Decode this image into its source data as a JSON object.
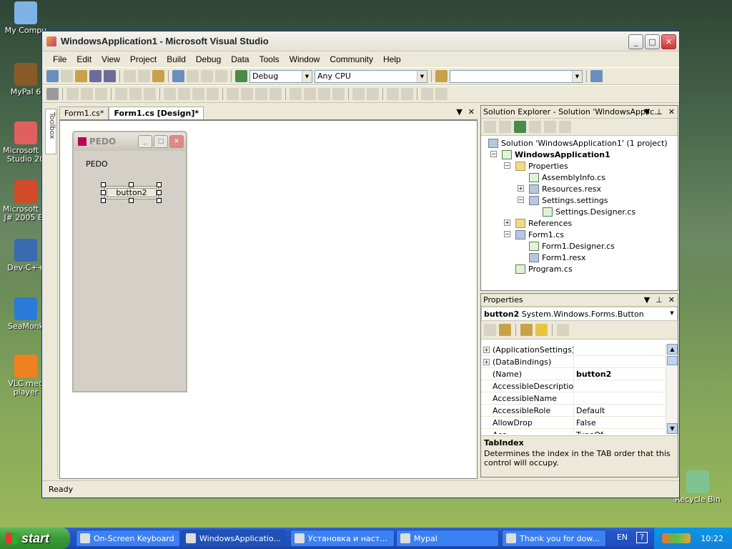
{
  "desktop": {
    "icons": [
      {
        "label": "My Compu",
        "color": "#7fb3e8"
      },
      {
        "label": "MyPal 6",
        "color": "#8a5a2a"
      },
      {
        "label": "Microsoft Vi\nStudio 20",
        "color": "#e06060"
      },
      {
        "label": "Microsoft Vi\nJ# 2005 Ex",
        "color": "#d24a2a"
      },
      {
        "label": "Dev-C++",
        "color": "#3a6ab0"
      },
      {
        "label": "SeaMonk",
        "color": "#2a7ad8"
      },
      {
        "label": "VLC med\nplayer",
        "color": "#f08020"
      },
      {
        "label": "Recycle Bin",
        "color": "#7fc48f"
      }
    ]
  },
  "window": {
    "title": "WindowsApplication1 - Microsoft Visual Studio",
    "menu": [
      "File",
      "Edit",
      "View",
      "Project",
      "Build",
      "Debug",
      "Data",
      "Tools",
      "Window",
      "Community",
      "Help"
    ],
    "config_combo": "Debug",
    "platform_combo": "Any CPU",
    "status": "Ready"
  },
  "toolbox": {
    "label": "Toolbox"
  },
  "document": {
    "tabs": [
      "Form1.cs*",
      "Form1.cs [Design]*"
    ],
    "active_tab": 1,
    "form": {
      "title": "PEDO",
      "label_text": "PEDO",
      "button_text": "button2"
    }
  },
  "solution_explorer": {
    "title": "Solution Explorer - Solution 'WindowsApplic...",
    "items": [
      {
        "label": "Solution 'WindowsApplication1' (1 project)",
        "indent": 0,
        "bold": false,
        "expander": "",
        "kind": "solution"
      },
      {
        "label": "WindowsApplication1",
        "indent": 1,
        "bold": true,
        "expander": "−",
        "kind": "cs"
      },
      {
        "label": "Properties",
        "indent": 2,
        "bold": false,
        "expander": "−",
        "kind": "folder"
      },
      {
        "label": "AssemblyInfo.cs",
        "indent": 3,
        "bold": false,
        "expander": "",
        "kind": "cs"
      },
      {
        "label": "Resources.resx",
        "indent": 3,
        "bold": false,
        "expander": "+",
        "kind": "file"
      },
      {
        "label": "Settings.settings",
        "indent": 3,
        "bold": false,
        "expander": "−",
        "kind": "file"
      },
      {
        "label": "Settings.Designer.cs",
        "indent": 4,
        "bold": false,
        "expander": "",
        "kind": "cs"
      },
      {
        "label": "References",
        "indent": 2,
        "bold": false,
        "expander": "+",
        "kind": "folder"
      },
      {
        "label": "Form1.cs",
        "indent": 2,
        "bold": false,
        "expander": "−",
        "kind": "file"
      },
      {
        "label": "Form1.Designer.cs",
        "indent": 3,
        "bold": false,
        "expander": "",
        "kind": "cs"
      },
      {
        "label": "Form1.resx",
        "indent": 3,
        "bold": false,
        "expander": "",
        "kind": "file"
      },
      {
        "label": "Program.cs",
        "indent": 2,
        "bold": false,
        "expander": "",
        "kind": "cs"
      }
    ]
  },
  "properties": {
    "title": "Properties",
    "object_name": "button2",
    "object_type": "System.Windows.Forms.Button",
    "rows": [
      {
        "name": "(ApplicationSettings)",
        "value": "",
        "plus": true,
        "bold": false
      },
      {
        "name": "(DataBindings)",
        "value": "",
        "plus": true,
        "bold": false
      },
      {
        "name": "(Name)",
        "value": "button2",
        "plus": false,
        "bold": true
      },
      {
        "name": "AccessibleDescription",
        "value": "",
        "plus": false,
        "bold": false
      },
      {
        "name": "AccessibleName",
        "value": "",
        "plus": false,
        "bold": false
      },
      {
        "name": "AccessibleRole",
        "value": "Default",
        "plus": false,
        "bold": false
      },
      {
        "name": "AllowDrop",
        "value": "False",
        "plus": false,
        "bold": false
      },
      {
        "name": "Acc",
        "value": "TypeOf",
        "plus": false,
        "bold": false
      }
    ],
    "desc_title": "TabIndex",
    "desc_text": "Determines the index in the TAB order that this control will occupy."
  },
  "taskbar": {
    "start": "start",
    "tasks": [
      "On-Screen Keyboard",
      "WindowsApplicatio...",
      "Установка и наст...",
      "Mypal",
      "Thank you for dow..."
    ],
    "active_task": 1,
    "lang": "EN",
    "clock": "10:22"
  }
}
